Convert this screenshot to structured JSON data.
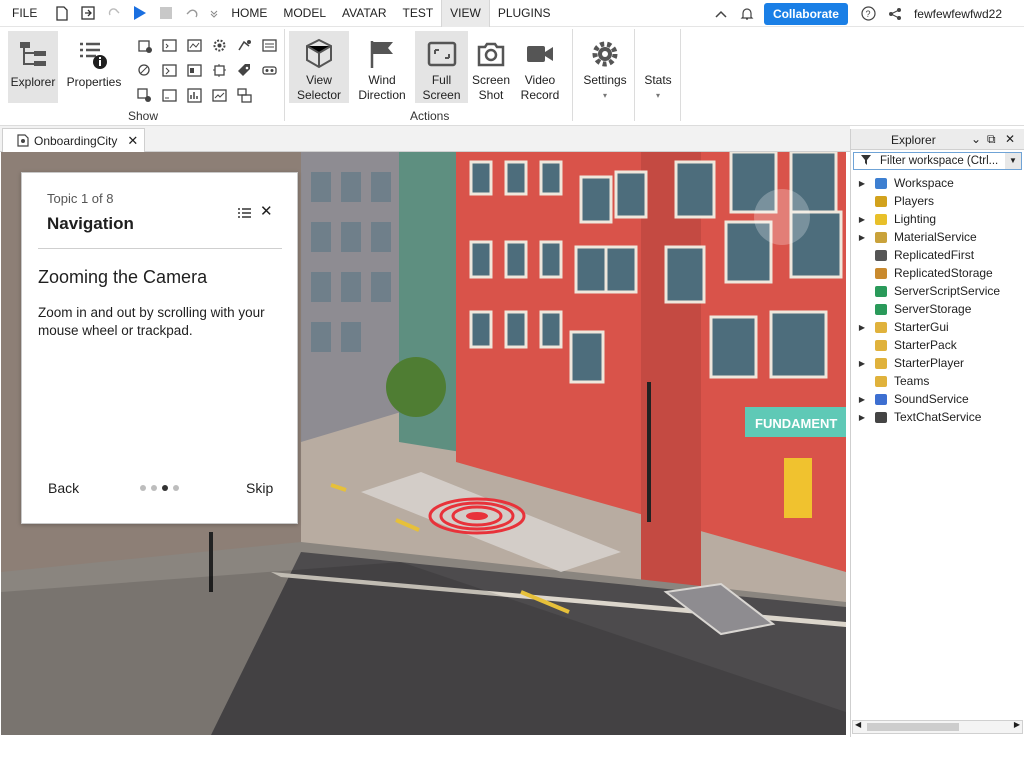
{
  "menubar": {
    "file": "FILE",
    "tabs": [
      "HOME",
      "MODEL",
      "AVATAR",
      "TEST",
      "VIEW",
      "PLUGINS"
    ],
    "active_tab": "VIEW",
    "collaborate": "Collaborate",
    "username": "fewfewfewfwd22"
  },
  "ribbon": {
    "explorer": "Explorer",
    "properties": "Properties",
    "show_label": "Show",
    "view_selector": [
      "View",
      "Selector"
    ],
    "wind_direction": [
      "Wind",
      "Direction"
    ],
    "full_screen": [
      "Full",
      "Screen"
    ],
    "screen_shot": [
      "Screen",
      "Shot"
    ],
    "video_record": [
      "Video",
      "Record"
    ],
    "actions_label": "Actions",
    "settings": "Settings",
    "stats": "Stats"
  },
  "document_tab": {
    "label": "OnboardingCity"
  },
  "onboarding": {
    "topic": "Topic 1 of 8",
    "title": "Navigation",
    "heading": "Zooming the Camera",
    "body": "Zoom in and out by scrolling with your mouse wheel or trackpad.",
    "back": "Back",
    "skip": "Skip",
    "dots_total": 4,
    "dots_active": 2
  },
  "viewport": {
    "sign_text": "FUNDAMENT"
  },
  "explorer": {
    "title": "Explorer",
    "filter_placeholder": "Filter workspace (Ctrl...",
    "items": [
      {
        "label": "Workspace",
        "expandable": true,
        "icon": "globe-icon",
        "color": "#3d7fd1"
      },
      {
        "label": "Players",
        "expandable": false,
        "icon": "players-icon",
        "color": "#d2a21d"
      },
      {
        "label": "Lighting",
        "expandable": true,
        "icon": "bulb-icon",
        "color": "#e8c02a"
      },
      {
        "label": "MaterialService",
        "expandable": true,
        "icon": "material-icon",
        "color": "#c9a23a"
      },
      {
        "label": "ReplicatedFirst",
        "expandable": false,
        "icon": "replicated-first-icon",
        "color": "#555555"
      },
      {
        "label": "ReplicatedStorage",
        "expandable": false,
        "icon": "replicated-storage-icon",
        "color": "#c98a2e"
      },
      {
        "label": "ServerScriptService",
        "expandable": false,
        "icon": "server-script-icon",
        "color": "#2a9a5a"
      },
      {
        "label": "ServerStorage",
        "expandable": false,
        "icon": "server-storage-icon",
        "color": "#2a9a5a"
      },
      {
        "label": "StarterGui",
        "expandable": true,
        "icon": "starter-gui-icon",
        "color": "#e0b23c"
      },
      {
        "label": "StarterPack",
        "expandable": false,
        "icon": "starter-pack-icon",
        "color": "#e0b23c"
      },
      {
        "label": "StarterPlayer",
        "expandable": true,
        "icon": "starter-player-icon",
        "color": "#e0b23c"
      },
      {
        "label": "Teams",
        "expandable": false,
        "icon": "teams-icon",
        "color": "#e0b23c"
      },
      {
        "label": "SoundService",
        "expandable": true,
        "icon": "sound-icon",
        "color": "#3d6fd1"
      },
      {
        "label": "TextChatService",
        "expandable": true,
        "icon": "chat-icon",
        "color": "#444444"
      }
    ]
  }
}
